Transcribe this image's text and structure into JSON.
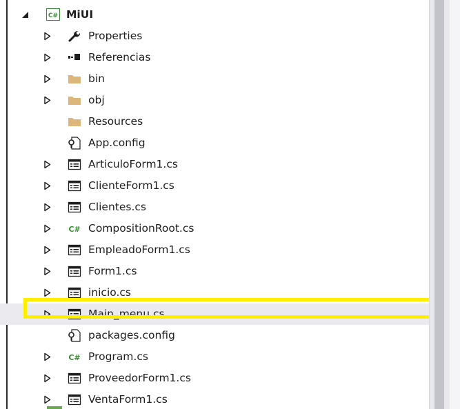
{
  "project": {
    "name": "MiUI",
    "icon": "csharp-project-icon",
    "expanded": true
  },
  "items": [
    {
      "label": "Properties",
      "icon": "wrench-icon",
      "has_arrow": true
    },
    {
      "label": "Referencias",
      "icon": "references-icon",
      "has_arrow": true
    },
    {
      "label": "bin",
      "icon": "folder-icon",
      "has_arrow": true
    },
    {
      "label": "obj",
      "icon": "folder-icon",
      "has_arrow": true
    },
    {
      "label": "Resources",
      "icon": "folder-icon",
      "has_arrow": false
    },
    {
      "label": "App.config",
      "icon": "config-file-icon",
      "has_arrow": false
    },
    {
      "label": "ArticuloForm1.cs",
      "icon": "form-icon",
      "has_arrow": true
    },
    {
      "label": "ClienteForm1.cs",
      "icon": "form-icon",
      "has_arrow": true
    },
    {
      "label": "Clientes.cs",
      "icon": "form-icon",
      "has_arrow": true
    },
    {
      "label": "CompositionRoot.cs",
      "icon": "csharp-file-icon",
      "has_arrow": true
    },
    {
      "label": "EmpleadoForm1.cs",
      "icon": "form-icon",
      "has_arrow": true
    },
    {
      "label": "Form1.cs",
      "icon": "form-icon",
      "has_arrow": true
    },
    {
      "label": "inicio.cs",
      "icon": "form-icon",
      "has_arrow": true
    },
    {
      "label": "Main_menu.cs",
      "icon": "form-icon",
      "has_arrow": true,
      "highlighted": true
    },
    {
      "label": "packages.config",
      "icon": "config-file-icon",
      "has_arrow": false
    },
    {
      "label": "Program.cs",
      "icon": "csharp-file-icon",
      "has_arrow": true
    },
    {
      "label": "ProveedorForm1.cs",
      "icon": "form-icon",
      "has_arrow": true
    },
    {
      "label": "VentaForm1.cs",
      "icon": "form-icon",
      "has_arrow": true
    }
  ],
  "colors": {
    "highlight_border": "#ffee00",
    "folder": "#dcb67a",
    "csharp": "#388a34",
    "icon_dark": "#424242",
    "selected_row": "#ebebef"
  }
}
